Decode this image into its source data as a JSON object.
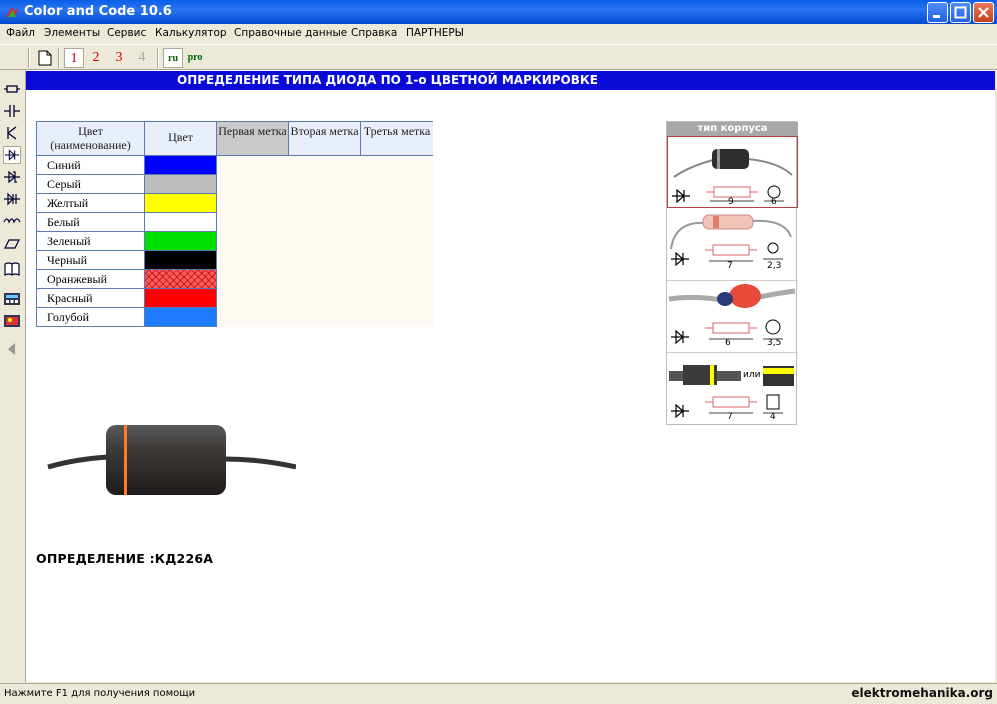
{
  "window": {
    "title": "Color and Code 10.6"
  },
  "menu": [
    "Файл",
    "Элементы",
    "Сервис",
    "Калькулятор",
    "Справочные данные",
    "Справка",
    "ПАРТНЕРЫ"
  ],
  "toolbar": {
    "b1": "1",
    "b2": "2",
    "b3": "3",
    "b4": "4",
    "ru": "ru",
    "pro": "pro"
  },
  "header": {
    "title": "ОПРЕДЕЛЕНИЕ ТИПА ДИОДА ПО 1-о ЦВЕТНОЙ МАРКИРОВКЕ"
  },
  "table": {
    "headers": [
      "Цвет (наименование)",
      "Цвет",
      "Первая метка",
      "Вторая метка",
      "Третья метка"
    ],
    "rows": [
      {
        "name": "Синий",
        "color": "#0000ff"
      },
      {
        "name": "Серый",
        "color": "#bdbdbd"
      },
      {
        "name": "Желтый",
        "color": "#ffff00"
      },
      {
        "name": "Белый",
        "color": "#ffffff"
      },
      {
        "name": "Зеленый",
        "color": "#00e000"
      },
      {
        "name": "Черный",
        "color": "#000000"
      },
      {
        "name": "Оранжевый",
        "color": "#ff5a5a"
      },
      {
        "name": "Красный",
        "color": "#ff0000"
      },
      {
        "name": "Голубой",
        "color": "#1e7cff"
      }
    ]
  },
  "case_panel": {
    "title": "тип корпуса",
    "cases": [
      {
        "length": "9",
        "diameter": "6"
      },
      {
        "length": "7",
        "diameter": "2,3"
      },
      {
        "length": "6",
        "diameter": "3,5"
      },
      {
        "length": "7",
        "diameter": "4",
        "alt": "или"
      }
    ]
  },
  "result": {
    "label": "ОПРЕДЕЛЕНИЕ :КД226А"
  },
  "status": {
    "text": "Нажмите F1 для получения помощи",
    "watermark": "elektromehanika.org"
  },
  "colors": {
    "titlebar": "#0a5fe8",
    "header": "#0a0ad6",
    "band": "#ff7a2a"
  }
}
